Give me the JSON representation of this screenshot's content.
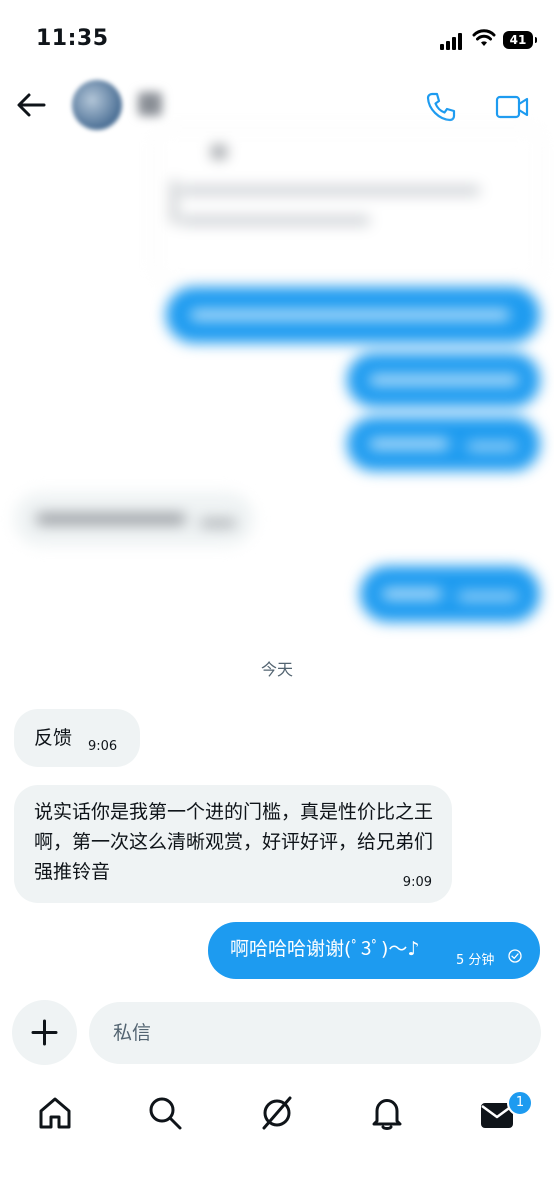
{
  "status_bar": {
    "time": "11:35",
    "battery": "41"
  },
  "header": {
    "back_icon": "arrow-left-icon",
    "phone_icon": "phone-icon",
    "video_icon": "video-camera-icon"
  },
  "colors": {
    "accent": "#1d9bf0",
    "incoming_bubble": "#eff3f4",
    "secondary_text": "#536471"
  },
  "date_separator": "今天",
  "messages": [
    {
      "direction": "incoming",
      "text": "反馈",
      "time": "9:06"
    },
    {
      "direction": "incoming",
      "text": "说实话你是我第一个进的门槛，真是性价比之王啊，第一次这么清晰观赏，好评好评，给兄弟们强推铃音",
      "time": "9:09"
    },
    {
      "direction": "outgoing",
      "text": "啊哈哈哈谢谢(ﾟ3ﾟ)～♪",
      "time": "5 分钟",
      "status_icon": "sent-check-icon"
    }
  ],
  "composer": {
    "placeholder": "私信",
    "value": ""
  },
  "tab_bar": {
    "items": [
      "home-icon",
      "search-icon",
      "grok-icon",
      "notifications-bell-icon",
      "messages-envelope-icon"
    ],
    "messages_badge": "1"
  }
}
